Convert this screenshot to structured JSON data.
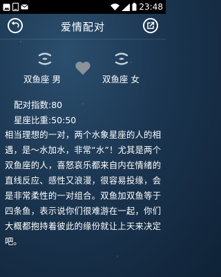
{
  "status_bar": {
    "time": "23:48"
  },
  "header": {
    "title": "爱情配对"
  },
  "match": {
    "left_sign": "双鱼座 男",
    "right_sign": "双鱼座 女"
  },
  "stats": {
    "score": "配对指数:80",
    "ratio": "星座比重:50:50"
  },
  "description": "相当理想的一对，两个水象星座的人的相遇，是～水加水，非常“水”！尤其是两个双鱼座的人，喜怒哀乐都来自内在情绪的直线反应、感性又浪漫，很容易投缘，会是非常柔性的一对组合。双鱼加双鱼等于四条鱼，表示说你们很难游在一起，你们大概都抱持着彼此的缘份就让上天来决定吧。",
  "icons": {
    "back": "back-arrow-icon",
    "share": "share-icon",
    "heart": "heart-icon",
    "sign": "pisces-icon"
  },
  "colors": {
    "background": "#1b3550",
    "heart": "#8a929a",
    "status_bar": "#000000"
  }
}
